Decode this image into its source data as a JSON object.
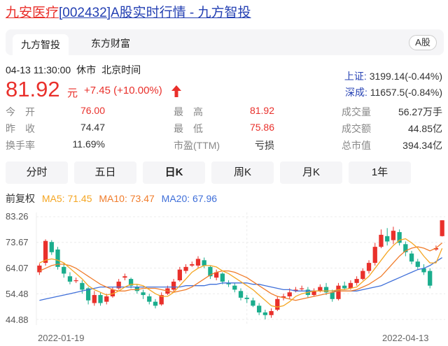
{
  "title": {
    "name": "九安医疗",
    "rest": "[002432]A股实时行情 - 九方智投"
  },
  "tabs": [
    {
      "label": "九方智投"
    },
    {
      "label": "东方财富"
    }
  ],
  "market_badge": "A股",
  "status": {
    "datetime": "04-13 11:30:00",
    "state": "休市",
    "timezone": "北京时间"
  },
  "price": {
    "value": "81.92",
    "unit": "元",
    "change": "+7.45 (+10.00%)"
  },
  "indices": [
    {
      "label": "上证:",
      "value": "3199.14(-0.44%)"
    },
    {
      "label": "深成:",
      "value": "11657.5(-0.84%)"
    }
  ],
  "stats": {
    "open": {
      "label": "今　开",
      "value": "76.00"
    },
    "prev_close": {
      "label": "昨　收",
      "value": "74.47"
    },
    "turnover_rate": {
      "label": "换手率",
      "value": "11.69%"
    },
    "high": {
      "label": "最　高",
      "value": "81.92"
    },
    "low": {
      "label": "最　低",
      "value": "75.86"
    },
    "pe": {
      "label": "市盈(TTM)",
      "value": "亏损"
    },
    "volume": {
      "label": "成交量",
      "value": "56.27万手"
    },
    "amount": {
      "label": "成交额",
      "value": "44.85亿"
    },
    "market_cap": {
      "label": "总市值",
      "value": "394.34亿"
    }
  },
  "periods": [
    "分时",
    "五日",
    "日K",
    "周K",
    "月K",
    "1年"
  ],
  "active_period": "日K",
  "ma_legend": {
    "adjust": "前复权",
    "ma5": "MA5: 71.45",
    "ma10": "MA10: 73.47",
    "ma20": "MA20: 67.96"
  },
  "colors": {
    "up": "#e9302b",
    "down": "#1aad8d",
    "ma5": "#f5a623",
    "ma10": "#f07c2b",
    "ma20": "#3f6fd9",
    "link": "#2440b3"
  },
  "chart_data": {
    "type": "candlestick",
    "y_ticks": [
      "83.26",
      "73.67",
      "64.07",
      "54.48",
      "44.88"
    ],
    "ylim": [
      44.88,
      83.26
    ],
    "x_tick_labels": [
      "2022-01-19",
      "2022-04-13"
    ],
    "candles": [
      [
        62.5,
        65.0,
        65.8,
        61.5
      ],
      [
        66.0,
        74.2,
        74.8,
        65.0
      ],
      [
        73.8,
        70.0,
        74.5,
        69.0
      ],
      [
        71.0,
        64.5,
        72.0,
        63.5
      ],
      [
        64.5,
        62.0,
        66.0,
        60.5
      ],
      [
        61.0,
        59.0,
        62.5,
        58.0
      ],
      [
        59.5,
        59.5,
        60.5,
        58.5
      ],
      [
        58.5,
        56.0,
        59.5,
        54.5
      ],
      [
        56.5,
        52.0,
        57.0,
        50.5
      ],
      [
        51.0,
        54.0,
        55.5,
        50.0
      ],
      [
        54.0,
        51.0,
        55.0,
        50.0
      ],
      [
        51.5,
        53.5,
        54.5,
        50.5
      ],
      [
        53.5,
        56.0,
        57.0,
        53.0
      ],
      [
        56.5,
        59.0,
        60.0,
        56.0
      ],
      [
        60.5,
        61.0,
        62.0,
        59.5
      ],
      [
        60.0,
        57.5,
        60.5,
        56.5
      ],
      [
        57.0,
        55.5,
        58.0,
        54.5
      ],
      [
        55.0,
        54.0,
        56.0,
        52.5
      ],
      [
        53.5,
        51.5,
        54.5,
        50.5
      ],
      [
        51.5,
        50.0,
        52.5,
        49.0
      ],
      [
        50.5,
        54.0,
        55.0,
        50.0
      ],
      [
        54.5,
        56.5,
        57.5,
        54.0
      ],
      [
        56.0,
        59.0,
        60.0,
        55.0
      ],
      [
        59.5,
        63.5,
        64.5,
        59.0
      ],
      [
        63.0,
        64.5,
        65.5,
        62.0
      ],
      [
        65.0,
        65.5,
        66.5,
        64.5
      ],
      [
        65.0,
        67.5,
        68.5,
        64.0
      ],
      [
        67.0,
        65.0,
        68.0,
        64.0
      ],
      [
        64.5,
        61.0,
        65.0,
        60.0
      ],
      [
        60.5,
        62.5,
        63.5,
        59.5
      ],
      [
        62.0,
        59.0,
        62.5,
        58.0
      ],
      [
        58.5,
        58.0,
        59.5,
        57.0
      ],
      [
        57.5,
        56.0,
        58.5,
        55.0
      ],
      [
        55.5,
        53.0,
        56.5,
        52.0
      ],
      [
        53.0,
        52.5,
        54.0,
        51.0
      ],
      [
        52.0,
        50.0,
        53.0,
        49.5
      ],
      [
        50.0,
        47.5,
        51.0,
        46.5
      ],
      [
        47.5,
        46.5,
        48.5,
        44.88
      ],
      [
        46.5,
        48.0,
        49.0,
        45.5
      ],
      [
        48.5,
        52.5,
        53.5,
        48.0
      ],
      [
        53.0,
        53.5,
        54.5,
        52.0
      ],
      [
        53.5,
        55.0,
        56.5,
        52.5
      ],
      [
        55.5,
        56.0,
        57.0,
        55.0
      ],
      [
        56.5,
        56.5,
        57.5,
        55.5
      ],
      [
        56.0,
        54.0,
        57.0,
        53.0
      ],
      [
        54.0,
        55.5,
        56.5,
        53.5
      ],
      [
        55.5,
        57.0,
        58.0,
        55.0
      ],
      [
        57.0,
        55.0,
        58.5,
        54.0
      ],
      [
        55.0,
        52.5,
        56.0,
        51.5
      ],
      [
        52.5,
        57.5,
        58.5,
        52.0
      ],
      [
        57.5,
        56.5,
        59.0,
        56.0
      ],
      [
        56.5,
        58.5,
        59.5,
        56.0
      ],
      [
        58.5,
        60.0,
        61.0,
        57.5
      ],
      [
        60.0,
        63.0,
        64.0,
        59.5
      ],
      [
        63.0,
        66.0,
        67.0,
        62.0
      ],
      [
        66.0,
        72.0,
        73.5,
        65.0
      ],
      [
        72.0,
        76.5,
        78.5,
        71.5
      ],
      [
        76.0,
        74.0,
        79.0,
        72.5
      ],
      [
        74.5,
        78.0,
        79.5,
        73.0
      ],
      [
        77.5,
        73.5,
        78.5,
        72.5
      ],
      [
        73.0,
        70.0,
        74.0,
        68.5
      ],
      [
        69.5,
        66.5,
        70.5,
        65.5
      ],
      [
        66.5,
        64.5,
        67.5,
        63.5
      ],
      [
        64.0,
        62.5,
        65.5,
        61.5
      ],
      [
        63.0,
        57.5,
        64.0,
        56.5
      ],
      [
        71.0,
        71.5,
        72.5,
        70.5
      ],
      [
        76.0,
        81.92,
        81.92,
        75.86
      ]
    ],
    "ma5": [
      66.0,
      67.0,
      67.5,
      67.0,
      66.0,
      64.0,
      62.0,
      60.0,
      57.5,
      56.0,
      55.0,
      54.0,
      54.5,
      55.5,
      57.0,
      58.0,
      58.0,
      57.5,
      56.0,
      54.5,
      53.5,
      53.5,
      55.0,
      57.5,
      60.0,
      62.5,
      64.0,
      65.0,
      65.0,
      64.5,
      63.0,
      62.0,
      60.5,
      59.0,
      57.5,
      56.0,
      54.0,
      52.0,
      50.0,
      49.5,
      50.0,
      51.5,
      53.5,
      54.5,
      55.0,
      55.5,
      55.5,
      55.5,
      55.5,
      56.0,
      56.0,
      56.5,
      57.0,
      59.0,
      61.0,
      64.0,
      67.0,
      70.0,
      72.5,
      74.5,
      75.0,
      73.5,
      71.5,
      68.5,
      66.0,
      66.0,
      71.45
    ],
    "ma10": [
      63.0,
      64.0,
      65.0,
      65.5,
      65.5,
      65.0,
      64.0,
      62.5,
      61.0,
      59.5,
      58.0,
      57.0,
      56.0,
      55.5,
      55.5,
      56.0,
      56.0,
      56.5,
      56.5,
      56.5,
      56.0,
      55.5,
      55.0,
      55.5,
      56.0,
      57.0,
      58.5,
      60.0,
      61.5,
      62.5,
      63.0,
      63.0,
      62.5,
      61.5,
      60.5,
      59.0,
      57.5,
      56.0,
      54.5,
      53.5,
      53.0,
      52.5,
      52.0,
      52.5,
      53.0,
      53.5,
      54.0,
      54.5,
      55.0,
      55.5,
      55.5,
      55.5,
      56.0,
      57.0,
      58.0,
      59.5,
      61.0,
      63.5,
      66.0,
      68.5,
      70.5,
      71.5,
      72.0,
      71.5,
      70.5,
      71.5,
      73.47
    ],
    "ma20": [
      52.0,
      52.5,
      53.0,
      53.5,
      54.0,
      54.5,
      55.0,
      55.5,
      56.0,
      56.5,
      57.0,
      57.0,
      57.0,
      57.0,
      57.0,
      57.0,
      57.0,
      57.0,
      57.0,
      57.0,
      57.0,
      57.0,
      57.0,
      57.0,
      57.5,
      57.5,
      57.5,
      57.5,
      58.0,
      58.0,
      58.5,
      58.5,
      58.5,
      58.5,
      58.5,
      58.0,
      58.0,
      57.5,
      57.0,
      56.5,
      56.0,
      56.0,
      55.5,
      55.5,
      55.5,
      55.5,
      55.5,
      55.5,
      55.5,
      55.5,
      55.5,
      55.5,
      55.5,
      56.0,
      56.5,
      57.0,
      57.5,
      58.5,
      59.5,
      60.5,
      61.5,
      62.5,
      63.5,
      64.0,
      65.0,
      66.5,
      67.96
    ]
  }
}
